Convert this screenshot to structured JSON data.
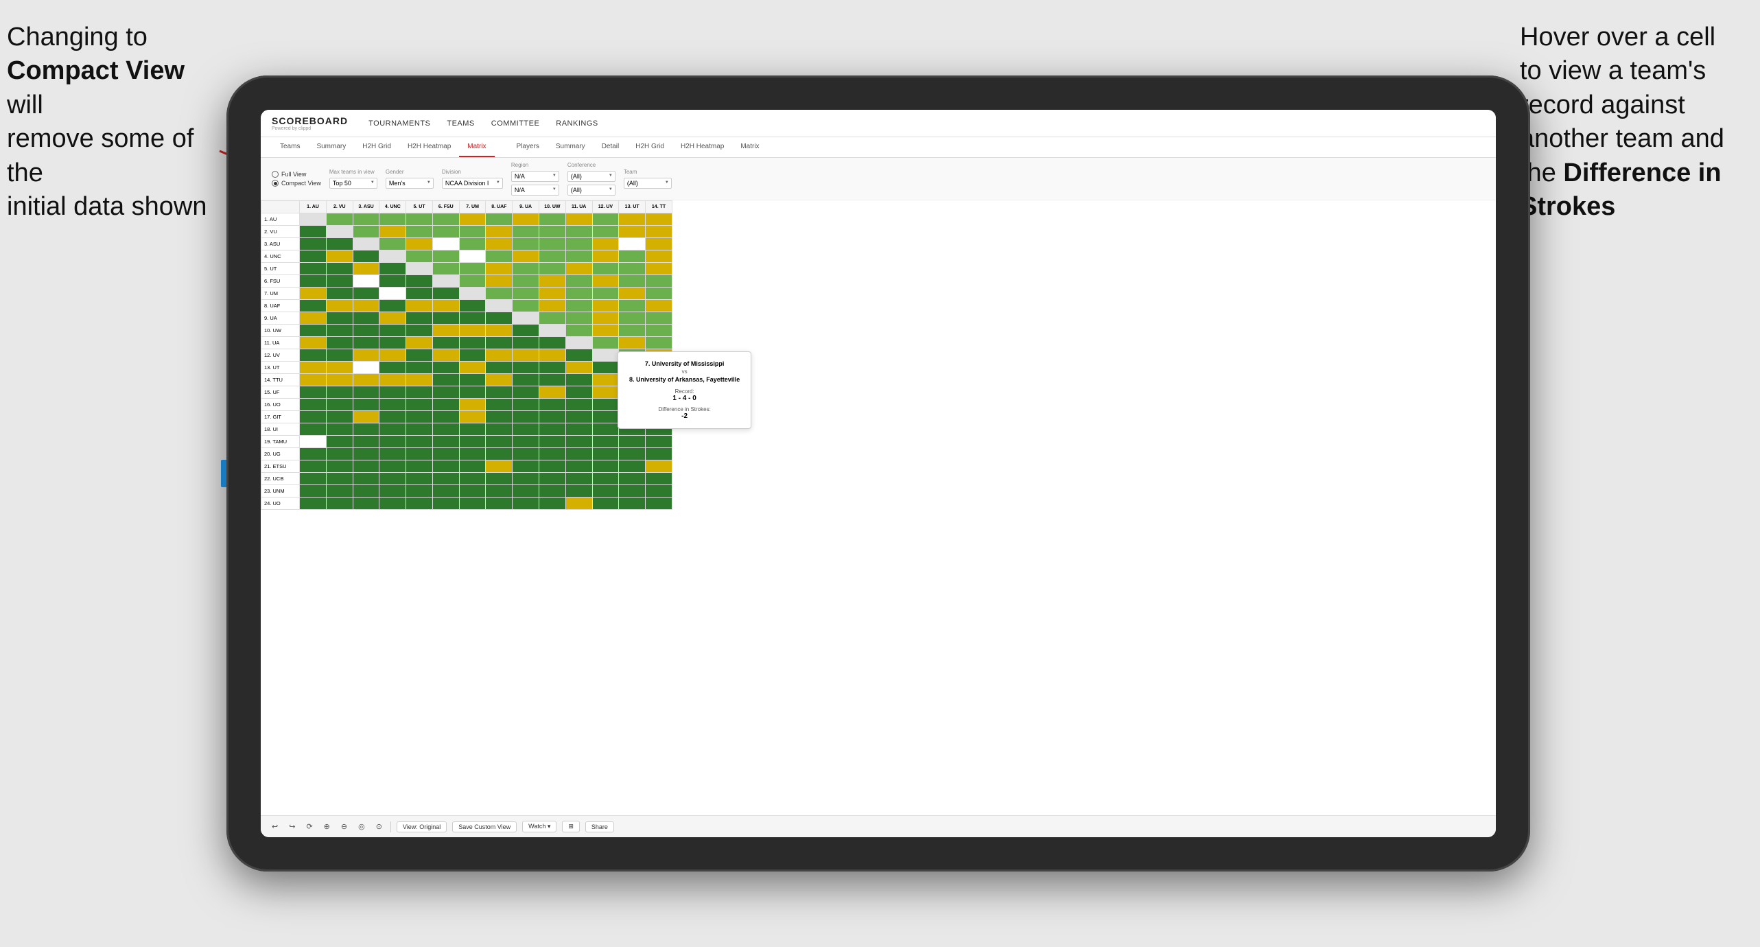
{
  "annotations": {
    "left": {
      "line1": "Changing to",
      "line2bold": "Compact View",
      "line3": " will",
      "line4": "remove some of the",
      "line5": "initial data shown"
    },
    "right": {
      "line1": "Hover over a cell",
      "line2": "to view a team's",
      "line3": "record against",
      "line4": "another team and",
      "line5bold": "the ",
      "line5rest": "Difference in",
      "line6bold": "Strokes"
    }
  },
  "nav": {
    "logo": "SCOREBOARD",
    "logo_sub": "Powered by clippd",
    "links": [
      "TOURNAMENTS",
      "TEAMS",
      "COMMITTEE",
      "RANKINGS"
    ]
  },
  "sub_tabs": {
    "group1": [
      "Teams",
      "Summary",
      "H2H Grid",
      "H2H Heatmap",
      "Matrix"
    ],
    "group2": [
      "Players",
      "Summary",
      "Detail",
      "H2H Grid",
      "H2H Heatmap",
      "Matrix"
    ],
    "active": "Matrix"
  },
  "controls": {
    "view_options": [
      "Full View",
      "Compact View"
    ],
    "view_selected": "Compact View",
    "fields": [
      {
        "label": "Max teams in view",
        "value": "Top 50"
      },
      {
        "label": "Gender",
        "value": "Men's"
      },
      {
        "label": "Division",
        "value": "NCAA Division I"
      },
      {
        "label": "Region",
        "value": "N/A",
        "value2": "N/A"
      },
      {
        "label": "Conference",
        "value": "(All)",
        "value2": "(All)"
      },
      {
        "label": "Team",
        "value": "(All)"
      }
    ]
  },
  "col_headers": [
    "1. AU",
    "2. VU",
    "3. ASU",
    "4. UNC",
    "5. UT",
    "6. FSU",
    "7. UM",
    "8. UAF",
    "9. UA",
    "10. UW",
    "11. UA",
    "12. UV",
    "13. UT",
    "14. TT"
  ],
  "rows": [
    {
      "label": "1. AU",
      "cells": [
        "",
        "g",
        "g",
        "g",
        "g",
        "g",
        "y",
        "g",
        "y",
        "g",
        "y",
        "g",
        "y",
        "y"
      ]
    },
    {
      "label": "2. VU",
      "cells": [
        "dg",
        "",
        "g",
        "y",
        "g",
        "g",
        "g",
        "y",
        "g",
        "g",
        "g",
        "g",
        "y",
        "y"
      ]
    },
    {
      "label": "3. ASU",
      "cells": [
        "dg",
        "dg",
        "",
        "g",
        "y",
        "w",
        "g",
        "y",
        "g",
        "g",
        "g",
        "y",
        "w",
        "y"
      ]
    },
    {
      "label": "4. UNC",
      "cells": [
        "dg",
        "y",
        "dg",
        "",
        "g",
        "g",
        "w",
        "g",
        "y",
        "g",
        "g",
        "y",
        "g",
        "y"
      ]
    },
    {
      "label": "5. UT",
      "cells": [
        "dg",
        "dg",
        "y",
        "dg",
        "",
        "g",
        "g",
        "y",
        "g",
        "g",
        "y",
        "g",
        "g",
        "y"
      ]
    },
    {
      "label": "6. FSU",
      "cells": [
        "dg",
        "dg",
        "w",
        "dg",
        "dg",
        "",
        "g",
        "y",
        "g",
        "y",
        "g",
        "y",
        "g",
        "g"
      ]
    },
    {
      "label": "7. UM",
      "cells": [
        "y",
        "dg",
        "dg",
        "w",
        "dg",
        "dg",
        "",
        "g",
        "g",
        "y",
        "g",
        "g",
        "y",
        "g"
      ]
    },
    {
      "label": "8. UAF",
      "cells": [
        "dg",
        "y",
        "y",
        "dg",
        "y",
        "y",
        "dg",
        "",
        "g",
        "y",
        "g",
        "y",
        "g",
        "y"
      ]
    },
    {
      "label": "9. UA",
      "cells": [
        "y",
        "dg",
        "dg",
        "y",
        "dg",
        "dg",
        "dg",
        "dg",
        "",
        "g",
        "g",
        "y",
        "g",
        "g"
      ]
    },
    {
      "label": "10. UW",
      "cells": [
        "dg",
        "dg",
        "dg",
        "dg",
        "dg",
        "y",
        "y",
        "y",
        "dg",
        "",
        "g",
        "y",
        "g",
        "g"
      ]
    },
    {
      "label": "11. UA",
      "cells": [
        "y",
        "dg",
        "dg",
        "dg",
        "y",
        "dg",
        "dg",
        "dg",
        "dg",
        "dg",
        "",
        "g",
        "y",
        "g"
      ]
    },
    {
      "label": "12. UV",
      "cells": [
        "dg",
        "dg",
        "y",
        "y",
        "dg",
        "y",
        "dg",
        "y",
        "y",
        "y",
        "dg",
        "",
        "g",
        "y"
      ]
    },
    {
      "label": "13. UT",
      "cells": [
        "y",
        "y",
        "w",
        "dg",
        "dg",
        "dg",
        "y",
        "dg",
        "dg",
        "dg",
        "y",
        "dg",
        "",
        "g"
      ]
    },
    {
      "label": "14. TTU",
      "cells": [
        "y",
        "y",
        "y",
        "y",
        "y",
        "dg",
        "dg",
        "y",
        "dg",
        "dg",
        "dg",
        "y",
        "dg",
        ""
      ]
    },
    {
      "label": "15. UF",
      "cells": [
        "dg",
        "dg",
        "dg",
        "dg",
        "dg",
        "dg",
        "dg",
        "dg",
        "dg",
        "y",
        "dg",
        "y",
        "y",
        "y"
      ]
    },
    {
      "label": "16. UO",
      "cells": [
        "dg",
        "dg",
        "dg",
        "dg",
        "dg",
        "dg",
        "y",
        "dg",
        "dg",
        "dg",
        "dg",
        "dg",
        "dg",
        "y"
      ]
    },
    {
      "label": "17. GIT",
      "cells": [
        "dg",
        "dg",
        "y",
        "dg",
        "dg",
        "dg",
        "y",
        "dg",
        "dg",
        "dg",
        "dg",
        "dg",
        "y",
        "dg"
      ]
    },
    {
      "label": "18. UI",
      "cells": [
        "dg",
        "dg",
        "dg",
        "dg",
        "dg",
        "dg",
        "dg",
        "dg",
        "dg",
        "dg",
        "dg",
        "dg",
        "dg",
        "dg"
      ]
    },
    {
      "label": "19. TAMU",
      "cells": [
        "w",
        "dg",
        "dg",
        "dg",
        "dg",
        "dg",
        "dg",
        "dg",
        "dg",
        "dg",
        "dg",
        "dg",
        "dg",
        "dg"
      ]
    },
    {
      "label": "20. UG",
      "cells": [
        "dg",
        "dg",
        "dg",
        "dg",
        "dg",
        "dg",
        "dg",
        "dg",
        "dg",
        "dg",
        "dg",
        "dg",
        "dg",
        "dg"
      ]
    },
    {
      "label": "21. ETSU",
      "cells": [
        "dg",
        "dg",
        "dg",
        "dg",
        "dg",
        "dg",
        "dg",
        "y",
        "dg",
        "dg",
        "dg",
        "dg",
        "dg",
        "y"
      ]
    },
    {
      "label": "22. UCB",
      "cells": [
        "dg",
        "dg",
        "dg",
        "dg",
        "dg",
        "dg",
        "dg",
        "dg",
        "dg",
        "dg",
        "dg",
        "dg",
        "dg",
        "dg"
      ]
    },
    {
      "label": "23. UNM",
      "cells": [
        "dg",
        "dg",
        "dg",
        "dg",
        "dg",
        "dg",
        "dg",
        "dg",
        "dg",
        "dg",
        "dg",
        "dg",
        "dg",
        "dg"
      ]
    },
    {
      "label": "24. UO",
      "cells": [
        "dg",
        "dg",
        "dg",
        "dg",
        "dg",
        "dg",
        "dg",
        "dg",
        "dg",
        "dg",
        "y",
        "dg",
        "dg",
        "dg"
      ]
    }
  ],
  "tooltip": {
    "team1": "7. University of Mississippi",
    "vs": "vs",
    "team2": "8. University of Arkansas, Fayetteville",
    "record_label": "Record:",
    "record_value": "1 - 4 - 0",
    "strokes_label": "Difference in Strokes:",
    "strokes_value": "-2"
  },
  "bottom_toolbar": {
    "icons": [
      "↩",
      "↪",
      "⟳",
      "⊕",
      "⊖",
      "⊙",
      "⊘"
    ],
    "buttons": [
      "View: Original",
      "Save Custom View",
      "Watch ▾",
      "⊞",
      "Share"
    ]
  }
}
